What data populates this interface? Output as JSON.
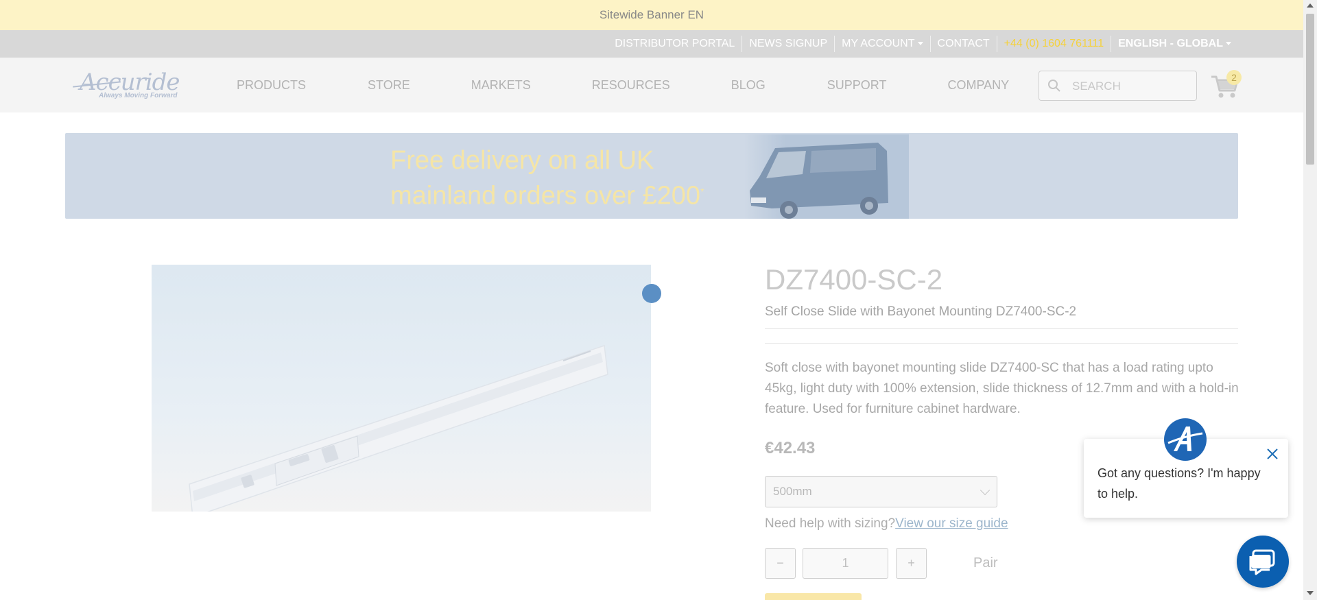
{
  "banner": {
    "text": "Sitewide Banner EN"
  },
  "utility": {
    "distributor": "DISTRIBUTOR PORTAL",
    "news": "NEWS SIGNUP",
    "account": "MY ACCOUNT",
    "contact": "CONTACT",
    "phone": "+44 (0) 1604 761111",
    "language": "ENGLISH - GLOBAL"
  },
  "brand": {
    "name": "Accuride",
    "tagline": "Always Moving Forward"
  },
  "nav": {
    "items": [
      {
        "label": "PRODUCTS"
      },
      {
        "label": "STORE"
      },
      {
        "label": "MARKETS"
      },
      {
        "label": "RESOURCES"
      },
      {
        "label": "BLOG"
      },
      {
        "label": "SUPPORT"
      },
      {
        "label": "COMPANY"
      }
    ],
    "search_placeholder": "SEARCH",
    "cart_count": "2"
  },
  "promo": {
    "line1": "Free delivery on all UK",
    "line2": "mainland orders over £200",
    "asterisk": "*"
  },
  "product": {
    "sku": "DZ7400-SC-2",
    "title": "Self Close Slide with Bayonet Mounting DZ7400-SC-2",
    "description": "Soft close with bayonet mounting slide DZ7400-SC that has a load rating upto 45kg, light duty with 100% extension, slide thickness of 12.7mm and with a hold-in feature. Used for furniture cabinet hardware.",
    "price": "€42.43",
    "size_selected": "500mm",
    "sizing_text": "Need help with sizing?",
    "sizing_link": "View our size guide",
    "minus": "−",
    "plus": "+",
    "quantity": "1",
    "unit": "Pair"
  },
  "chat": {
    "message": "Got any questions? I'm happy to help."
  },
  "colors": {
    "brand_blue": "#0b5fb0",
    "banner_yellow": "#fdf3c6",
    "phone_yellow": "#f5d23c"
  }
}
